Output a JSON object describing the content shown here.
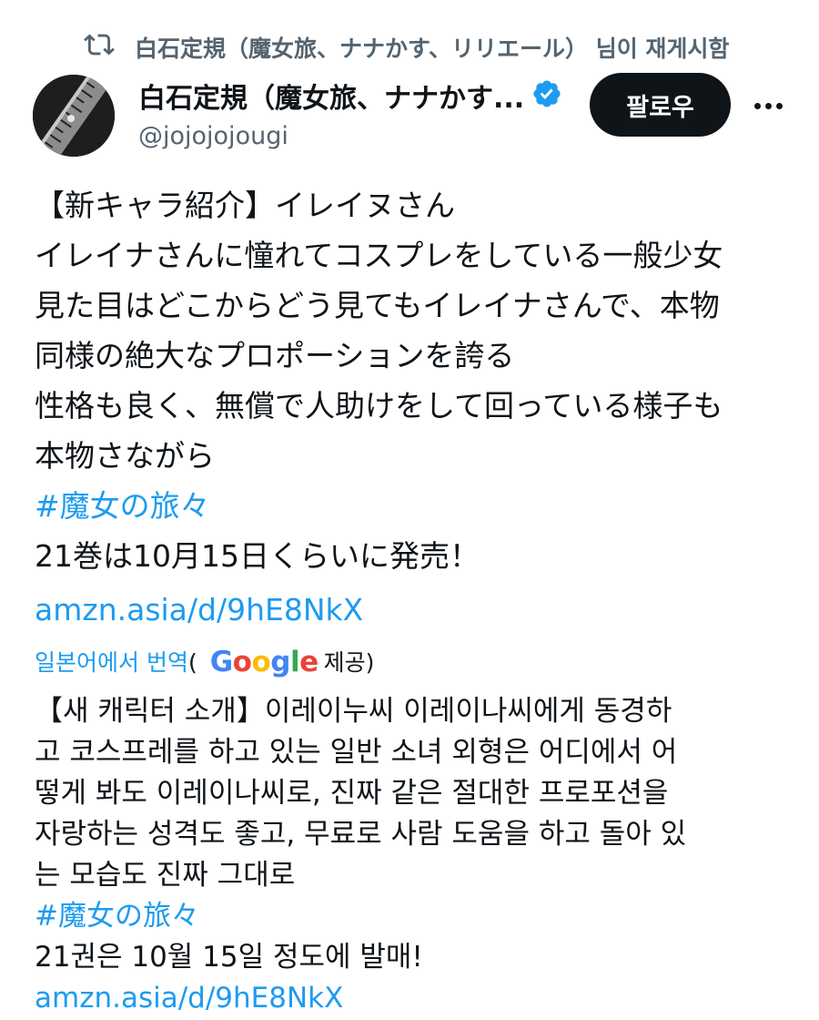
{
  "retweet": {
    "icon": "retweet-icon",
    "text": "白石定規（魔女旅、ナナかす、リリエール） 님이 재게시함"
  },
  "author": {
    "display_name": "白石定規（魔女旅、ナナかす...",
    "handle": "@jojojojougi",
    "verified_icon": "verified-badge-icon",
    "verified_color": "#1d9bf0"
  },
  "actions": {
    "follow_label": "팔로우",
    "more_icon": "more-icon"
  },
  "post": {
    "lines": [
      "【新キャラ紹介】イレイヌさん",
      "イレイナさんに憧れてコスプレをしている一般少女",
      "見た目はどこからどう見てもイレイナさんで、本物",
      "同様の絶大なプロポーションを誇る",
      "性格も良く、無償で人助けをして回っている様子も",
      "本物さながら"
    ],
    "hashtag": "#魔女の旅々",
    "release": "21巻は10月15日くらいに発売！",
    "link": "amzn.asia/d/9hE8NkX"
  },
  "translation": {
    "label": "일본어에서 번역",
    "open_paren": "(",
    "provider": "Google",
    "provided_by": "제공)",
    "lines": [
      "【새 캐릭터 소개】이레이누씨 이레이나씨에게 동경하",
      "고 코스프레를 하고 있는 일반 소녀 외형은 어디에서 어",
      "떻게 봐도 이레이나씨로, 진짜 같은 절대한 프로포션을",
      "자랑하는 성격도 좋고, 무료로 사람 도움을 하고 돌아 있",
      "는 모습도 진짜 그대로"
    ],
    "hashtag": "#魔女の旅々",
    "release": "21권은 10월 15일 정도에 발매!",
    "link": "amzn.asia/d/9hE8NkX"
  },
  "colors": {
    "link": "#1d9bf0",
    "muted": "#536471",
    "text": "#0f1419"
  }
}
